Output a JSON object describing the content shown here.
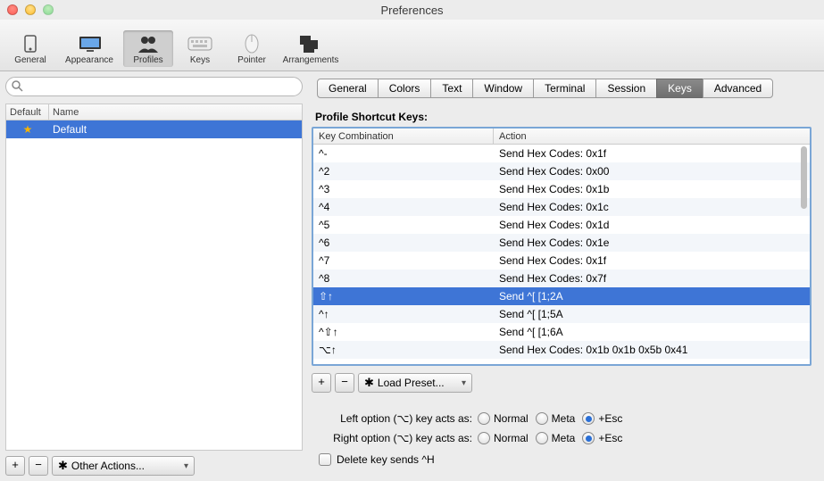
{
  "window_title": "Preferences",
  "toolbar": [
    {
      "id": "general",
      "label": "General"
    },
    {
      "id": "appearance",
      "label": "Appearance"
    },
    {
      "id": "profiles",
      "label": "Profiles",
      "selected": true
    },
    {
      "id": "keys",
      "label": "Keys"
    },
    {
      "id": "pointer",
      "label": "Pointer"
    },
    {
      "id": "arrangements",
      "label": "Arrangements"
    }
  ],
  "search_placeholder": "",
  "profile_columns": {
    "default": "Default",
    "name": "Name"
  },
  "profiles": [
    {
      "name": "Default",
      "starred": true,
      "selected": true
    }
  ],
  "left_actions": {
    "add": "+",
    "remove": "−",
    "other_actions": "Other Actions..."
  },
  "right_tabs": [
    "General",
    "Colors",
    "Text",
    "Window",
    "Terminal",
    "Session",
    "Keys",
    "Advanced"
  ],
  "right_tab_active": "Keys",
  "section_title": "Profile Shortcut Keys:",
  "keys_columns": {
    "combo": "Key Combination",
    "action": "Action"
  },
  "keys": [
    {
      "combo": "^-",
      "action": "Send Hex Codes: 0x1f"
    },
    {
      "combo": "^2",
      "action": "Send Hex Codes: 0x00"
    },
    {
      "combo": "^3",
      "action": "Send Hex Codes: 0x1b"
    },
    {
      "combo": "^4",
      "action": "Send Hex Codes: 0x1c"
    },
    {
      "combo": "^5",
      "action": "Send Hex Codes: 0x1d"
    },
    {
      "combo": "^6",
      "action": "Send Hex Codes: 0x1e"
    },
    {
      "combo": "^7",
      "action": "Send Hex Codes: 0x1f"
    },
    {
      "combo": "^8",
      "action": "Send Hex Codes: 0x7f"
    },
    {
      "combo": "⇧↑",
      "action": "Send ^[ [1;2A",
      "selected": true
    },
    {
      "combo": "^↑",
      "action": "Send ^[ [1;5A"
    },
    {
      "combo": "^⇧↑",
      "action": "Send ^[ [1;6A"
    },
    {
      "combo": "⌥↑",
      "action": "Send Hex Codes: 0x1b 0x1b 0x5b 0x41"
    }
  ],
  "under_table": {
    "add": "+",
    "remove": "−",
    "load_preset": "Load Preset..."
  },
  "options": {
    "left_label": "Left option (⌥) key acts as:",
    "right_label": "Right option (⌥) key acts as:",
    "choices": [
      "Normal",
      "Meta",
      "+Esc"
    ],
    "left_selected": "+Esc",
    "right_selected": "+Esc",
    "delete_label": "Delete key sends ^H",
    "delete_checked": false
  }
}
